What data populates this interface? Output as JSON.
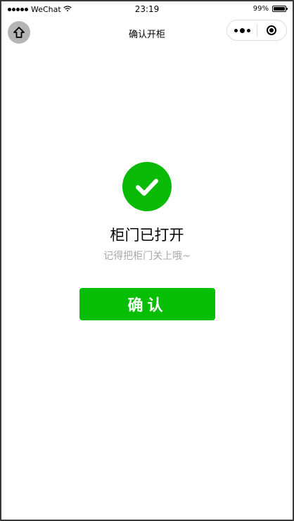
{
  "status_bar": {
    "carrier": "WeChat",
    "time": "23:19",
    "battery_percent": "99%",
    "battery_level": 0.99
  },
  "nav": {
    "title": "确认开柜",
    "home_icon": "home-icon",
    "more_icon": "more-dots-icon",
    "close_icon": "close-ring-icon"
  },
  "result": {
    "icon": "success-check-icon",
    "title": "柜门已打开",
    "subtitle": "记得把柜门关上哦~"
  },
  "actions": {
    "confirm_label": "确认"
  },
  "colors": {
    "success_green": "#09bb07",
    "button_green": "#06bf05",
    "subtitle_gray": "#a8a8a8"
  }
}
